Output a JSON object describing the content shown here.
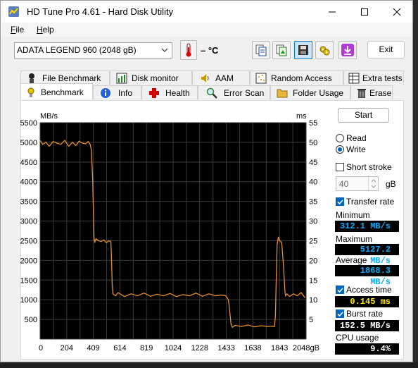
{
  "window": {
    "title": "HD Tune Pro 4.61 - Hard Disk Utility",
    "controls": {
      "minimize": "minimize-icon",
      "maximize": "maximize-icon",
      "close": "close-icon"
    }
  },
  "menu": {
    "items": [
      {
        "label": "File",
        "accel": "F",
        "rest": "ile"
      },
      {
        "label": "Help",
        "accel": "H",
        "rest": "elp"
      }
    ]
  },
  "toolbar": {
    "drive": "ADATA LEGEND 960 (2048 gB)",
    "temperature": "– °C",
    "exit_label": "Exit",
    "icons": [
      "thermometer-icon",
      "copy-text-icon",
      "copy-screenshot-icon",
      "save-icon",
      "options-icon",
      "download-icon"
    ]
  },
  "tabs": {
    "top": [
      "File Benchmark",
      "Disk monitor",
      "AAM",
      "Random Access",
      "Extra tests"
    ],
    "bottom": [
      "Benchmark",
      "Info",
      "Health",
      "Error Scan",
      "Folder Usage",
      "Erase"
    ],
    "selected": "Benchmark"
  },
  "chart": {
    "left_unit": "MB/s",
    "right_unit": "ms",
    "x_unit_label": "2048gB"
  },
  "side": {
    "start_label": "Start",
    "read_label": "Read",
    "write_label": "Write",
    "mode_selected": "Write",
    "short_stroke_label": "Short stroke",
    "short_stroke_checked": false,
    "stroke_value": "40",
    "stroke_unit": "gB",
    "transfer_rate_label": "Transfer rate",
    "transfer_rate_checked": true,
    "minimum_label": "Minimum",
    "minimum_value": "312.1 MB/s",
    "maximum_label": "Maximum",
    "maximum_value": "5127.2 MB/s",
    "average_label": "Average",
    "average_value": "1868.3 MB/s",
    "access_time_label": "Access time",
    "access_time_checked": true,
    "access_time_value": "0.145 ms",
    "burst_rate_label": "Burst rate",
    "burst_rate_checked": true,
    "burst_rate_value": "152.5 MB/s",
    "cpu_usage_label": "CPU usage",
    "cpu_usage_value": "9.4%"
  },
  "colors": {
    "plot_bg": "#000000",
    "grid": "#3a3a3a",
    "trace": "#e8912c",
    "readout_blue": "#00aeff",
    "readout_yellow": "#ffea00"
  },
  "chart_data": {
    "type": "line",
    "title": "",
    "xlabel": "",
    "ylabel": "MB/s",
    "y2label": "ms",
    "xlim": [
      0,
      2048
    ],
    "ylim": [
      0,
      5500
    ],
    "y2lim": [
      0,
      55
    ],
    "x_ticks": [
      "0",
      "204",
      "409",
      "614",
      "819",
      "1024",
      "1228",
      "1433",
      "1638",
      "1843",
      "2048gB"
    ],
    "y_ticks": [
      "500",
      "1000",
      "1500",
      "2000",
      "2500",
      "3000",
      "3500",
      "4000",
      "4500",
      "5000",
      "5500"
    ],
    "y2_ticks": [
      "5",
      "10",
      "15",
      "20",
      "25",
      "30",
      "35",
      "40",
      "45",
      "50",
      "55"
    ],
    "grid": true,
    "series": [
      {
        "x": [
          0,
          20,
          45,
          70,
          100,
          130,
          160,
          190,
          220,
          250,
          275,
          300,
          325,
          350,
          370,
          385,
          395,
          405,
          410,
          415,
          420,
          430,
          450,
          470,
          490,
          510,
          530,
          545,
          550,
          555,
          560,
          580,
          600,
          650,
          700,
          750,
          800,
          850,
          900,
          950,
          1000,
          1050,
          1100,
          1150,
          1200,
          1250,
          1300,
          1350,
          1400,
          1430,
          1450,
          1460,
          1470,
          1480,
          1500,
          1550,
          1600,
          1650,
          1700,
          1750,
          1790,
          1805,
          1812,
          1818,
          1825,
          1835,
          1845,
          1860,
          1875,
          1885,
          1890,
          1900,
          1920,
          1950,
          1980,
          2010,
          2040
        ],
        "y": [
          5050,
          4950,
          5000,
          4900,
          5020,
          4980,
          4950,
          5050,
          4900,
          5000,
          4920,
          5030,
          4980,
          4960,
          5020,
          4950,
          4800,
          4000,
          3200,
          2600,
          2450,
          2550,
          2500,
          2480,
          2520,
          2450,
          2500,
          2480,
          2000,
          1400,
          1150,
          1100,
          1180,
          1080,
          1150,
          1100,
          1170,
          1090,
          1140,
          1100,
          1160,
          1080,
          1130,
          1100,
          1170,
          1090,
          1150,
          1100,
          1120,
          1100,
          1000,
          700,
          380,
          300,
          350,
          320,
          360,
          310,
          340,
          320,
          330,
          320,
          600,
          1500,
          2400,
          2600,
          2500,
          2450,
          1800,
          1200,
          1100,
          1150,
          1080,
          1150,
          1100,
          1180,
          1050
        ]
      }
    ]
  }
}
